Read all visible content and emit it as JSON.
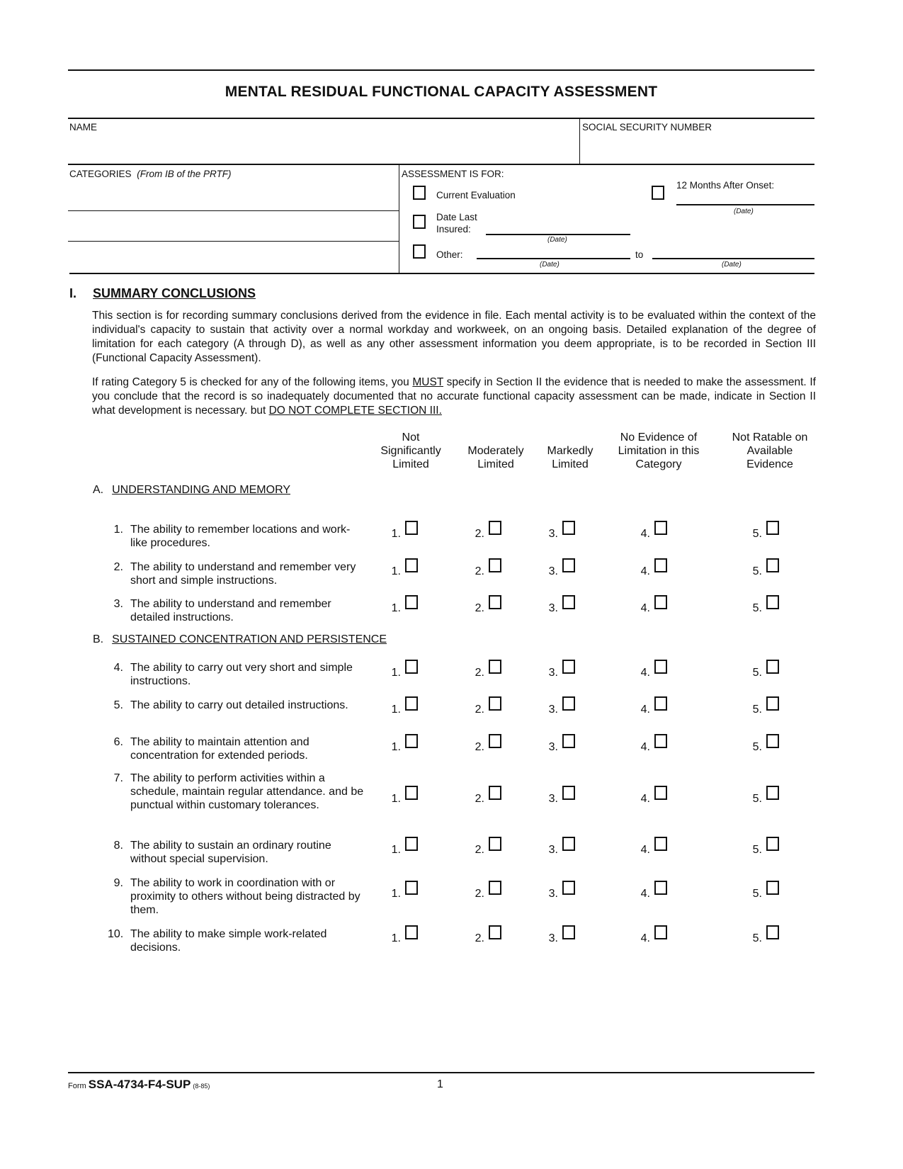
{
  "form": {
    "title": "MENTAL RESIDUAL FUNCTIONAL CAPACITY ASSESSMENT",
    "name_label": "NAME",
    "name_value": "",
    "ssn_label": "SOCIAL SECURITY NUMBER",
    "ssn_value": "",
    "categories_label": "CATEGORIES",
    "categories_note": "(From IB of the PRTF)",
    "assessment_for": {
      "label": "ASSESSMENT IS FOR:",
      "current_evaluation": "Current Evaluation",
      "date_last_insured_line1": "Date Last",
      "date_last_insured_line2": "Insured:",
      "twelve_months": "12 Months After Onset:",
      "other": "Other:",
      "to": "to",
      "date_caption": "(Date)",
      "checked": {
        "current_evaluation": false,
        "date_last_insured": false,
        "twelve_months": false,
        "other": false
      }
    }
  },
  "section1": {
    "roman": "I.",
    "heading": "SUMMARY CONCLUSIONS",
    "para1": "This section is for recording summary conclusions derived from the evidence in file. Each mental activity is to be evaluated within the context of the individual's capacity to sustain that activity over a normal workday and workweek, on an ongoing basis. Detailed explanation of the degree of limitation for each category (A through D), as well as any other assessment information you deem appropriate, is to be recorded in Section III (Functional Capacity Assessment).",
    "para2_a": "If rating Category 5 is checked for any of the following items, you ",
    "para2_must": "MUST",
    "para2_b": " specify in Section II the evidence that is needed to make the assessment. If you conclude that the record is so inadequately documented that no accurate functional capacity assessment can be made, indicate in Section II what development is necessary. but ",
    "para2_donot": "DO NOT COMPLETE SECTION III."
  },
  "columns": [
    {
      "line1": "Not",
      "line2": "Significantly",
      "line3": "Limited"
    },
    {
      "line1": "",
      "line2": "Moderately",
      "line3": "Limited"
    },
    {
      "line1": "",
      "line2": "Markedly",
      "line3": "Limited"
    },
    {
      "line1": "No Evidence of",
      "line2": "Limitation in this",
      "line3": "Category"
    },
    {
      "line1": "Not Ratable on",
      "line2": "Available",
      "line3": "Evidence"
    }
  ],
  "categories": [
    {
      "letter": "A.",
      "label": "UNDERSTANDING AND MEMORY"
    },
    {
      "letter": "B.",
      "label": "SUSTAINED CONCENTRATION AND PERSISTENCE"
    }
  ],
  "option_numbers": [
    "1.",
    "2.",
    "3.",
    "4.",
    "5."
  ],
  "items": [
    {
      "num": "1.",
      "text": "The ability to remember locations and work-like procedures.",
      "selected": null
    },
    {
      "num": "2.",
      "text": "The ability to understand and remember very short and simple instructions.",
      "selected": null
    },
    {
      "num": "3.",
      "text": "The ability to understand and remember detailed instructions.",
      "selected": null
    },
    {
      "num": "4.",
      "text": "The ability to carry out very short and simple instructions.",
      "selected": null
    },
    {
      "num": "5.",
      "text": "The ability to carry out detailed instructions.",
      "selected": null
    },
    {
      "num": "6.",
      "text": "The ability to maintain attention and concentration for extended periods.",
      "selected": null
    },
    {
      "num": "7.",
      "text": "The ability to perform activities within a schedule, maintain regular attendance. and be punctual within customary tolerances.",
      "selected": null
    },
    {
      "num": "8.",
      "text": "The ability to sustain an ordinary routine without special supervision.",
      "selected": null
    },
    {
      "num": "9.",
      "text": "The ability to work in coordination with or proximity to others without being distracted by them.",
      "selected": null
    },
    {
      "num": "10.",
      "text": "The ability to make simple work-related decisions.",
      "selected": null
    }
  ],
  "footer": {
    "form_prefix": "Form",
    "form_number": "SSA-4734-F4-SUP",
    "form_date": "(8-85)",
    "page_number": "1"
  }
}
